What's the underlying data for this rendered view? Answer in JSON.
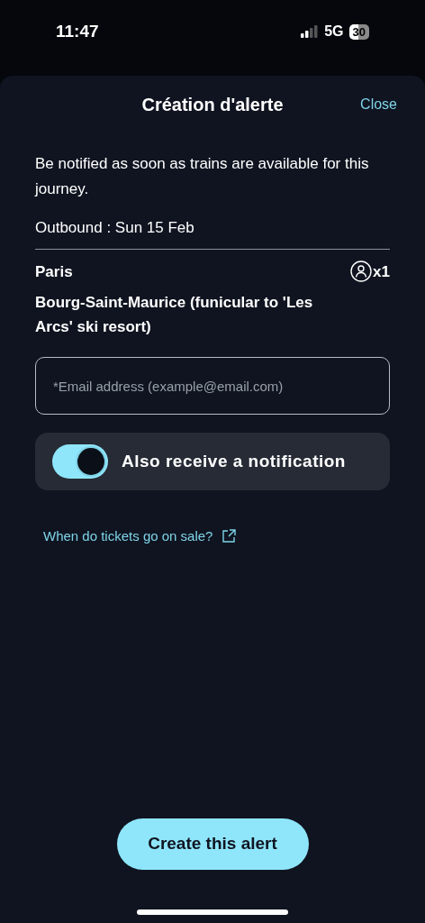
{
  "status_bar": {
    "time": "11:47",
    "network": "5G",
    "battery": "30"
  },
  "sheet": {
    "title": "Création d'alerte",
    "close": "Close"
  },
  "intro": "Be notified as soon as trains are available for this journey.",
  "outbound": "Outbound : Sun 15 Feb",
  "journey": {
    "origin": "Paris",
    "destination": "Bourg-Saint-Maurice (funicular to 'Les Arcs' ski resort)",
    "passengers": "x1"
  },
  "email": {
    "placeholder": "*Email address (example@email.com)"
  },
  "notification": {
    "label": "Also receive a notification",
    "checked": true
  },
  "link": "When do tickets go on sale?",
  "button": "Create this alert"
}
